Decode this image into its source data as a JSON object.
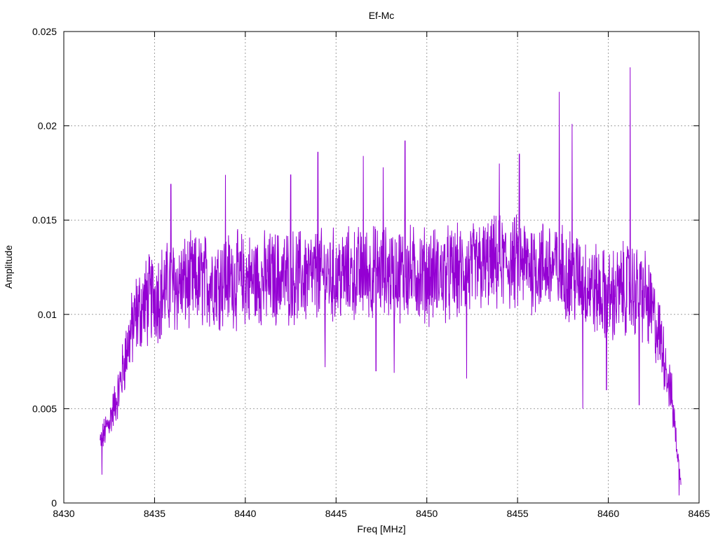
{
  "chart_data": {
    "type": "line",
    "title": "Ef-Mc",
    "xlabel": "Freq [MHz]",
    "ylabel": "Amplitude",
    "xlim": [
      8430,
      8465
    ],
    "ylim": [
      0,
      0.025
    ],
    "x_ticks": [
      8430,
      8435,
      8440,
      8445,
      8450,
      8455,
      8460,
      8465
    ],
    "x_tick_labels": [
      "8430",
      "8435",
      "8440",
      "8445",
      "8450",
      "8455",
      "8460",
      "8465"
    ],
    "y_ticks": [
      0,
      0.005,
      0.01,
      0.015,
      0.02,
      0.025
    ],
    "y_tick_labels": [
      "0",
      "0.005",
      "0.01",
      "0.015",
      "0.02",
      "0.025"
    ],
    "grid": true,
    "legend": "none",
    "series_color": "#9400d3",
    "series": [
      {
        "x_start": 8432.0,
        "x_end": 8464.0,
        "envelope": [
          [
            8432.0,
            0.0032
          ],
          [
            8432.5,
            0.0043
          ],
          [
            8433.0,
            0.0058
          ],
          [
            8433.5,
            0.0083
          ],
          [
            8434.0,
            0.01
          ],
          [
            8434.5,
            0.0106
          ],
          [
            8435.0,
            0.011
          ],
          [
            8436.0,
            0.0115
          ],
          [
            8437.0,
            0.0117
          ],
          [
            8438.0,
            0.0118
          ],
          [
            8439.0,
            0.0119
          ],
          [
            8440.0,
            0.0118
          ],
          [
            8441.0,
            0.0118
          ],
          [
            8442.0,
            0.012
          ],
          [
            8443.0,
            0.012
          ],
          [
            8444.0,
            0.012
          ],
          [
            8445.0,
            0.012
          ],
          [
            8446.0,
            0.0121
          ],
          [
            8447.0,
            0.0122
          ],
          [
            8448.0,
            0.0122
          ],
          [
            8449.0,
            0.0122
          ],
          [
            8450.0,
            0.0121
          ],
          [
            8451.0,
            0.0121
          ],
          [
            8452.0,
            0.0122
          ],
          [
            8453.0,
            0.0125
          ],
          [
            8454.0,
            0.0127
          ],
          [
            8455.0,
            0.0127
          ],
          [
            8456.0,
            0.0126
          ],
          [
            8457.0,
            0.0125
          ],
          [
            8458.0,
            0.0121
          ],
          [
            8459.0,
            0.0115
          ],
          [
            8460.0,
            0.0108
          ],
          [
            8461.0,
            0.0114
          ],
          [
            8462.0,
            0.011
          ],
          [
            8462.5,
            0.0098
          ],
          [
            8463.0,
            0.0082
          ],
          [
            8463.5,
            0.0055
          ],
          [
            8464.0,
            0.001
          ]
        ],
        "noise_amplitude": 0.0022,
        "peaks": [
          [
            8432.1,
            0.0015
          ],
          [
            8435.9,
            0.0169
          ],
          [
            8438.9,
            0.0174
          ],
          [
            8442.5,
            0.0174
          ],
          [
            8444.0,
            0.0186
          ],
          [
            8444.4,
            0.0072
          ],
          [
            8446.5,
            0.0184
          ],
          [
            8447.6,
            0.0178
          ],
          [
            8447.2,
            0.007
          ],
          [
            8448.8,
            0.0192
          ],
          [
            8448.2,
            0.0069
          ],
          [
            8452.2,
            0.0066
          ],
          [
            8454.0,
            0.018
          ],
          [
            8455.1,
            0.0185
          ],
          [
            8457.3,
            0.0218
          ],
          [
            8458.0,
            0.0201
          ],
          [
            8458.6,
            0.005
          ],
          [
            8459.9,
            0.006
          ],
          [
            8461.2,
            0.0231
          ],
          [
            8461.7,
            0.0052
          ],
          [
            8463.9,
            0.0004
          ]
        ]
      }
    ]
  }
}
